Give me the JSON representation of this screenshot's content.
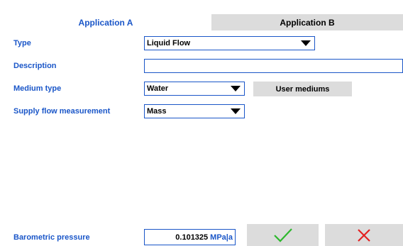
{
  "tabs": [
    {
      "label": "Application A",
      "active": true
    },
    {
      "label": "Application B",
      "active": false
    }
  ],
  "form": {
    "type": {
      "label": "Type",
      "value": "Liquid Flow"
    },
    "description": {
      "label": "Description",
      "value": ""
    },
    "medium_type": {
      "label": "Medium type",
      "value": "Water",
      "user_mediums_label": "User mediums"
    },
    "supply_flow": {
      "label": "Supply flow measurement",
      "value": "Mass"
    },
    "barometric": {
      "label": "Barometric pressure",
      "value": "0.101325",
      "unit": "MPa|a"
    }
  },
  "actions": {
    "confirm_icon": "checkmark-icon",
    "cancel_icon": "cross-icon",
    "confirm_color": "#2db82d",
    "cancel_color": "#e32020"
  },
  "colors": {
    "accent": "#1a56c8",
    "button_bg": "#dcdcdc"
  }
}
